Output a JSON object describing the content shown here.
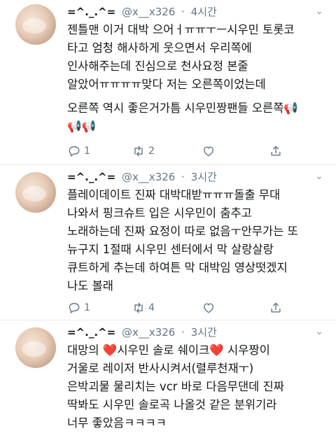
{
  "tweets": [
    {
      "name": "=^._.^=",
      "handle": "@x__x326",
      "time": "4시간",
      "paragraphs": [
        "젠틀맨 이거 대박 으어ㅓㅠㅠㅜㅡ시우민 토롯코\n타고 엄청 해사하게 웃으면서 우리쪽에\n인사해주는데 진심으로 천사요정 본줄\n알았어ㅠㅠㅠㅠ맞다 저는 오른쪽이었는데",
        "오른쪽 역시 좋은거가틈 시우민짱팬들 오른쪽📢\n📢📢"
      ],
      "replies": "1",
      "retweets": "2",
      "likes": ""
    },
    {
      "name": "=^._.^=",
      "handle": "@x__x326",
      "time": "3시간",
      "paragraphs": [
        "플레이데이트 진짜 대박대받ㅠㅠㅠ돌출 무대\n나와서 핑크슈트 입은 시우민이 춤추고\n노래하는데 진짜 요정이 따로 없음ㅜ안무가는 또\n뉴구지 1절때 시우민 센터에서 막 살랑살랑\n큐트하게 추는데 하여튼 막 대박임 영상떳겠지\n나도 볼래"
      ],
      "replies": "1",
      "retweets": "4",
      "likes": ""
    },
    {
      "name": "=^._.^=",
      "handle": "@x__x326",
      "time": "3시간",
      "paragraphs": [
        "대망의 ❤️시우민 솔로 쉐이크❤️ 시우짱이\n거울로 레이저 반사시켜서(렬루천재ㅜ)\n은박괴물 물리치는 vcr 바로 다음무댄데 진짜\n딱봐도 시우민 솔로곡 나올것 같은 분위기라\n너무 좋았음ㅋㅋㅋㅋ"
      ]
    }
  ]
}
